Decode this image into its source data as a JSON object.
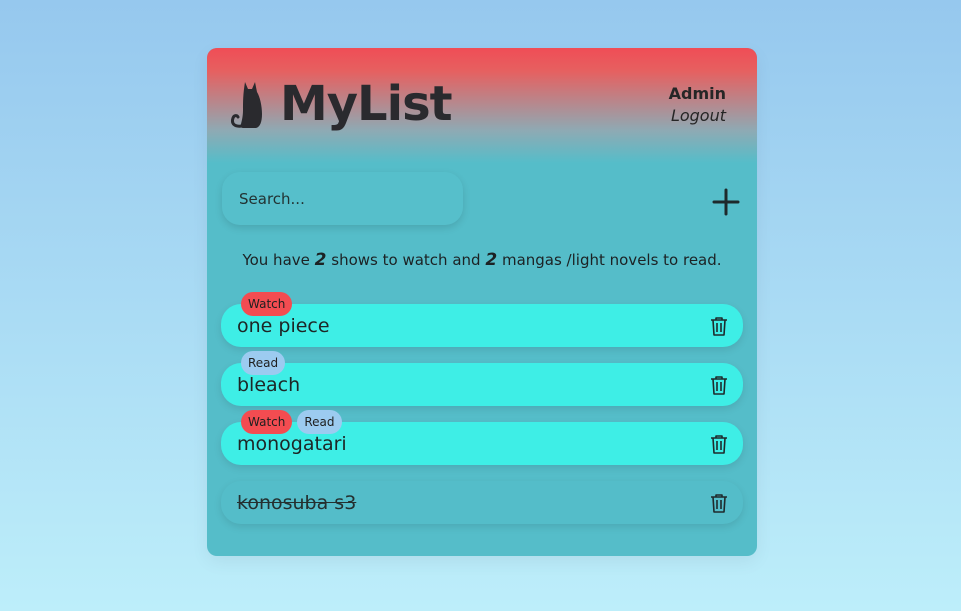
{
  "app": {
    "title": "MyList",
    "logo_icon": "cat-icon"
  },
  "user": {
    "name": "Admin",
    "logout_label": "Logout"
  },
  "search": {
    "placeholder": "Search...",
    "value": ""
  },
  "add_button": {
    "icon": "plus-icon"
  },
  "summary": {
    "prefix": "You have",
    "shows_count": "2",
    "middle": "shows to watch and",
    "mangas_count": "2",
    "suffix": "mangas /light novels to read."
  },
  "items": [
    {
      "name": "one piece",
      "tags": [
        "Watch"
      ],
      "completed": false
    },
    {
      "name": "bleach",
      "tags": [
        "Read"
      ],
      "completed": false
    },
    {
      "name": "monogatari",
      "tags": [
        "Watch",
        "Read"
      ],
      "completed": false
    },
    {
      "name": "konosuba s3",
      "tags": [],
      "completed": true
    }
  ],
  "colors": {
    "header_red": "#f04d56",
    "card_teal": "#55bdc9",
    "item_cyan": "#3eeee6",
    "watch_tag": "#f34c51",
    "read_tag": "#9ccbf0"
  }
}
